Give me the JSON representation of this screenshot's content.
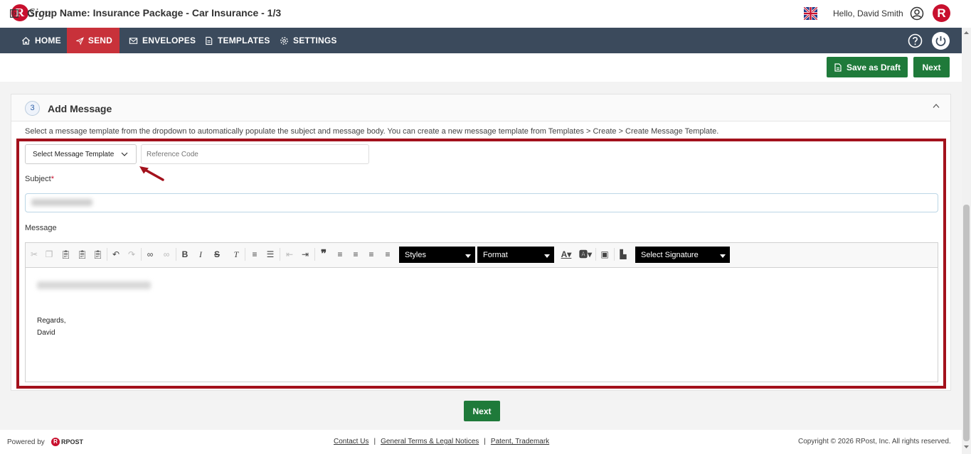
{
  "app": {
    "logo_text": "Sign",
    "logo_letter": "R",
    "greeting": "Hello, David Smith",
    "brand_letter": "R"
  },
  "nav": {
    "items": [
      {
        "label": "HOME",
        "icon": "home-icon"
      },
      {
        "label": "SEND",
        "icon": "send-icon",
        "active": true
      },
      {
        "label": "ENVELOPES",
        "icon": "envelope-icon"
      },
      {
        "label": "TEMPLATES",
        "icon": "document-icon"
      },
      {
        "label": "SETTINGS",
        "icon": "gear-icon"
      }
    ]
  },
  "group": {
    "title": "Group Name: Insurance Package - Car Insurance - 1/3",
    "save_draft_label": "Save as Draft",
    "next_label": "Next"
  },
  "step": {
    "number": "3",
    "title": "Add Message",
    "instructions": "Select a message template from the dropdown to automatically populate the subject and message body. You can create a new message template from Templates > Create > Create Message Template."
  },
  "form": {
    "template_select": "Select Message Template",
    "reference_placeholder": "Reference Code",
    "subject_label": "Subject",
    "required_mark": "*",
    "message_label": "Message"
  },
  "editor": {
    "styles_label": "Styles",
    "format_label": "Format",
    "signature_label": "Select Signature",
    "body_lines": [
      "Regards,",
      "David"
    ]
  },
  "bottom": {
    "next_label": "Next"
  },
  "footer": {
    "powered_by": "Powered by",
    "rpost_text": "RPOST",
    "links": [
      "Contact Us",
      "General Terms & Legal Notices",
      "Patent, Trademark"
    ],
    "separator": "|",
    "copyright": "Copyright © 2026 RPost, Inc. All rights reserved."
  },
  "colors": {
    "nav_bg": "#3b4a5c",
    "active_nav": "#c8313a",
    "brand_red": "#c8102e",
    "button_green": "#1f7a3a",
    "highlight_border": "#a3111c"
  }
}
